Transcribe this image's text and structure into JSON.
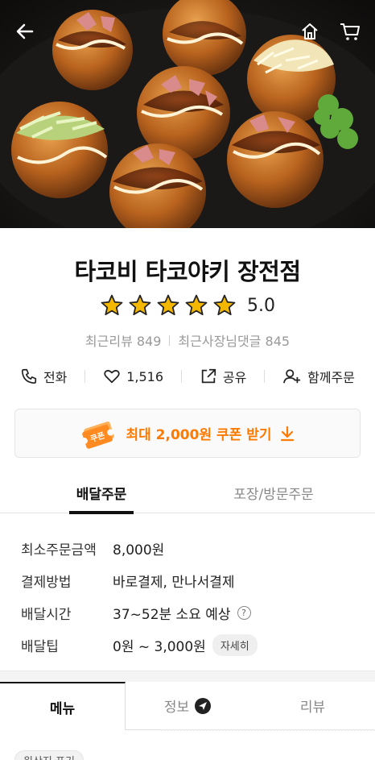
{
  "store": {
    "name": "타코비 타코야키 장전점",
    "rating": "5.0",
    "stars": 5,
    "recent_reviews": "최근리뷰 849",
    "owner_replies": "최근사장님댓글 845"
  },
  "actions": {
    "call": "전화",
    "likes": "1,516",
    "share": "공유",
    "group_order": "함께주문"
  },
  "coupon": {
    "label": "최대 2,000원 쿠폰 받기",
    "badge": "쿠폰"
  },
  "order_tabs": {
    "delivery": "배달주문",
    "pickup": "포장/방문주문"
  },
  "info": {
    "min_order_label": "최소주문금액",
    "min_order_value": "8,000원",
    "payment_label": "결제방법",
    "payment_value": "바로결제, 만나서결제",
    "delivery_time_label": "배달시간",
    "delivery_time_value": "37~52분 소요 예상",
    "delivery_tip_label": "배달팁",
    "delivery_tip_value": "0원 ~ 3,000원",
    "detail_label": "자세히"
  },
  "bottom_tabs": {
    "menu": "메뉴",
    "info": "정보",
    "review": "리뷰"
  },
  "chip": "원산지 표기",
  "colors": {
    "accent": "#ff7a00",
    "star": "#f5b800"
  }
}
